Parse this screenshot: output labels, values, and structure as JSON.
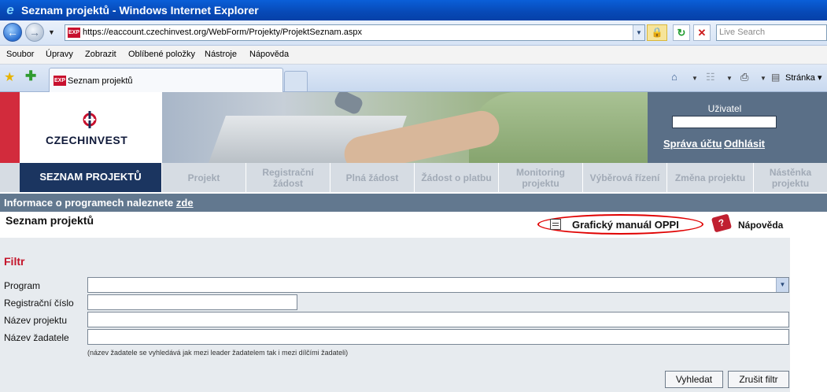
{
  "window": {
    "title": "Seznam projektů - Windows Internet Explorer",
    "url": "https://eaccount.czechinvest.org/WebForm/Projekty/ProjektSeznam.aspx",
    "search_placeholder": "Live Search"
  },
  "menu": [
    "Soubor",
    "Úpravy",
    "Zobrazit",
    "Oblíbené položky",
    "Nástroje",
    "Nápověda"
  ],
  "tab": {
    "label": "Seznam projektů",
    "page_menu": "Stránka"
  },
  "header": {
    "logo_part1": "CZECH",
    "logo_part2": "INVEST",
    "user_label": "Uživatel",
    "account_link": "Správa účtu",
    "logout_link": "Odhlásit"
  },
  "nav": {
    "active": "SEZNAM PROJEKTŮ",
    "items": [
      {
        "line1": "Projekt",
        "line2": ""
      },
      {
        "line1": "Registrační",
        "line2": "žádost"
      },
      {
        "line1": "Plná žádost",
        "line2": ""
      },
      {
        "line1": "Žádost o platbu",
        "line2": ""
      },
      {
        "line1": "Monitoring",
        "line2": "projektu"
      },
      {
        "line1": "Výběrová řízení",
        "line2": ""
      },
      {
        "line1": "Změna projektu",
        "line2": ""
      },
      {
        "line1": "Nástěnka",
        "line2": "projektu"
      }
    ]
  },
  "info": {
    "text": "Informace o programech naleznete ",
    "link": "zde"
  },
  "main": {
    "title": "Seznam projektů",
    "manual_link": "Grafický manuál OPPI",
    "help_link": "Nápověda"
  },
  "filter": {
    "title": "Filtr",
    "program_label": "Program",
    "program_value": "",
    "reg_label": "Registrační číslo",
    "reg_value": "",
    "name_label": "Název projektu",
    "name_value": "",
    "applicant_label": "Název žadatele",
    "applicant_value": "",
    "note": "(název žadatele se vyhledává jak mezi leader žadatelem tak i mezi dílčími žadateli)",
    "search_button": "Vyhledat",
    "cancel_button": "Zrušit filtr"
  },
  "colors": {
    "brand_red": "#d22b3c",
    "nav_active": "#1b3560",
    "info_bar": "#62788f",
    "filter_title": "#c4142a",
    "highlight_ring": "#e00000"
  }
}
